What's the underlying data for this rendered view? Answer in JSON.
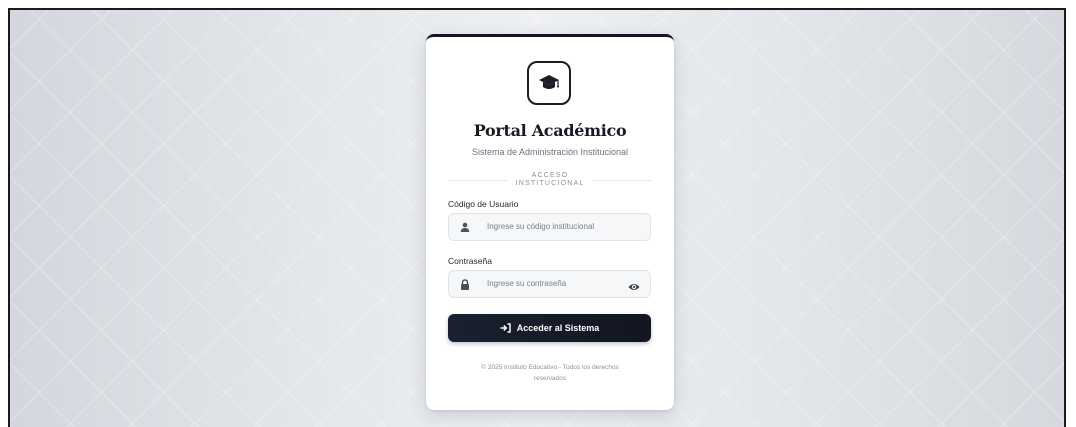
{
  "brand": {
    "logo_icon": "graduation-cap-icon",
    "title": "Portal Académico",
    "subtitle": "Sistema de Administración Institucional"
  },
  "divider": {
    "line1": "ACCESO",
    "line2": "INSTITUCIONAL"
  },
  "form": {
    "user_label": "Código de Usuario",
    "user_placeholder": "Ingrese su código institucional",
    "user_icon": "user-icon",
    "password_label": "Contraseña",
    "password_placeholder": "Ingrese su contraseña",
    "password_icon": "lock-icon",
    "toggle_icon": "eye-icon"
  },
  "submit": {
    "label": "Acceder al Sistema",
    "icon": "sign-in-icon"
  },
  "footer": {
    "line1": "© 2025 Instituto Educativo - Todos los derechos",
    "line2": "reservados"
  },
  "colors": {
    "primary": "#14171f",
    "background": "#e4e7eb",
    "input_bg": "#f5f7f9",
    "muted_text": "#6b7280"
  }
}
